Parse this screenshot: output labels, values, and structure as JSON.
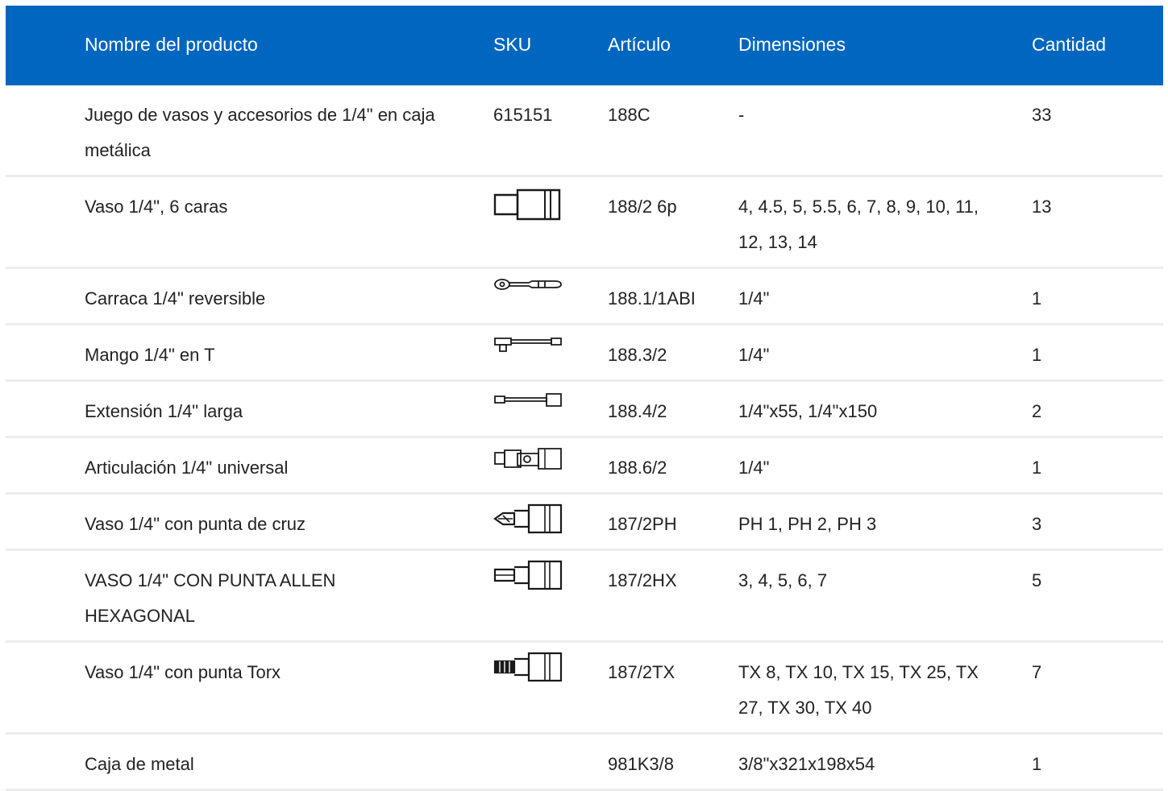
{
  "table": {
    "header": {
      "name": "Nombre del producto",
      "sku": "SKU",
      "article": "Artículo",
      "dimensions": "Dimensiones",
      "quantity": "Cantidad"
    },
    "rows": [
      {
        "name": "Juego de vasos y accesorios de 1/4\" en caja metálica",
        "sku": "615151",
        "icon": "",
        "article": "188C",
        "dimensions": "-",
        "quantity": "33"
      },
      {
        "name": "Vaso 1/4\", 6 caras",
        "sku": "",
        "icon": "socket-icon",
        "article": "188/2 6p",
        "dimensions": "4, 4.5, 5, 5.5, 6, 7, 8, 9, 10, 11, 12, 13, 14",
        "quantity": "13"
      },
      {
        "name": "Carraca 1/4\" reversible",
        "sku": "",
        "icon": "ratchet-icon",
        "article": "188.1/1ABI",
        "dimensions": "1/4\"",
        "quantity": "1"
      },
      {
        "name": "Mango 1/4\" en T",
        "sku": "",
        "icon": "t-handle-icon",
        "article": "188.3/2",
        "dimensions": "1/4\"",
        "quantity": "1"
      },
      {
        "name": "Extensión 1/4\" larga",
        "sku": "",
        "icon": "extension-bar-icon",
        "article": "188.4/2",
        "dimensions": "1/4\"x55, 1/4\"x150",
        "quantity": "2"
      },
      {
        "name": "Articulación 1/4\" universal",
        "sku": "",
        "icon": "universal-joint-icon",
        "article": "188.6/2",
        "dimensions": "1/4\"",
        "quantity": "1"
      },
      {
        "name": "Vaso 1/4\" con punta de cruz",
        "sku": "",
        "icon": "phillips-bit-socket-icon",
        "article": "187/2PH",
        "dimensions": "PH 1, PH 2, PH 3",
        "quantity": "3"
      },
      {
        "name": "VASO 1/4\" CON PUNTA ALLEN HEXAGONAL",
        "sku": "",
        "icon": "hex-bit-socket-icon",
        "article": "187/2HX",
        "dimensions": "3, 4, 5, 6, 7",
        "quantity": "5"
      },
      {
        "name": "Vaso 1/4\" con punta Torx",
        "sku": "",
        "icon": "torx-bit-socket-icon",
        "article": "187/2TX",
        "dimensions": "TX 8, TX 10, TX 15, TX 25, TX 27, TX 30, TX 40",
        "quantity": "7"
      },
      {
        "name": "Caja de metal",
        "sku": "",
        "icon": "",
        "article": "981K3/8",
        "dimensions": "3/8\"x321x198x54",
        "quantity": "1"
      }
    ]
  }
}
